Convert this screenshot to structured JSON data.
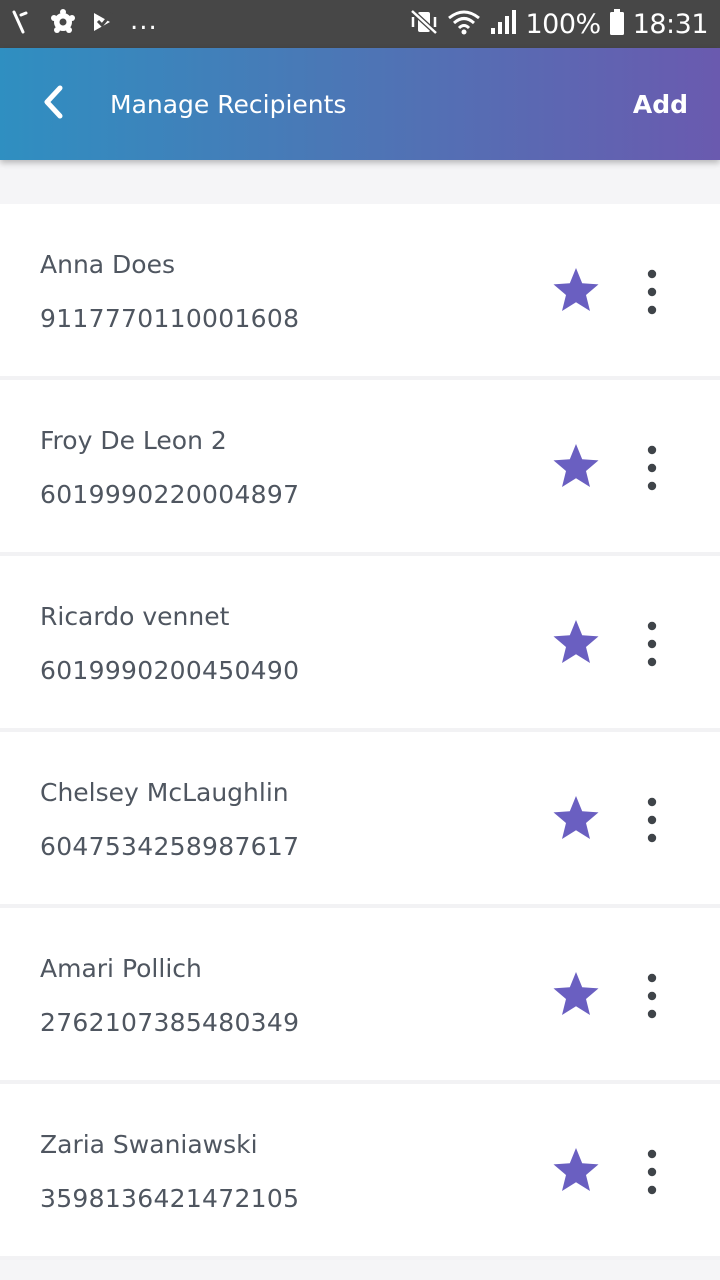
{
  "status_bar": {
    "overflow": "...",
    "battery_percent": "100%",
    "time": "18:31",
    "icons_left": [
      "tools-icon",
      "settings-gear-icon",
      "check-icon"
    ],
    "icons_right": [
      "mute-vibrate-icon",
      "wifi-icon",
      "signal-icon",
      "battery-icon"
    ]
  },
  "app_bar": {
    "title": "Manage Recipients",
    "add_label": "Add",
    "back_icon": "chevron-left-icon"
  },
  "colors": {
    "accent": "#6a5fc1",
    "gradient_start": "#2f8fc1",
    "gradient_end": "#6a5aaf"
  },
  "recipients": [
    {
      "name": "Anna Does",
      "number": "9117770110001608",
      "favorite": true
    },
    {
      "name": "Froy De Leon 2",
      "number": "6019990220004897",
      "favorite": true
    },
    {
      "name": "Ricardo vennet",
      "number": "6019990200450490",
      "favorite": true
    },
    {
      "name": "Chelsey McLaughlin",
      "number": "6047534258987617",
      "favorite": true
    },
    {
      "name": "Amari Pollich",
      "number": "2762107385480349",
      "favorite": true
    },
    {
      "name": "Zaria Swaniawski",
      "number": "3598136421472105",
      "favorite": true
    }
  ]
}
